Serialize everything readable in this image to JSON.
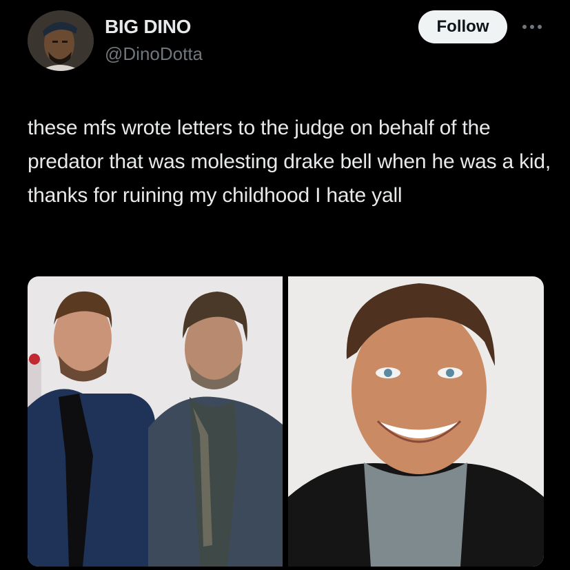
{
  "author": {
    "display_name": "BIG DINO",
    "handle": "@DinoDotta",
    "avatar_icon": "profile-avatar"
  },
  "header": {
    "follow_label": "Follow",
    "more_icon": "more-options-icon"
  },
  "tweet": {
    "text": "these mfs wrote letters to the judge on behalf of the predator that was molesting drake bell when he was a kid, thanks for ruining my childhood I hate yall"
  },
  "media": {
    "images": [
      {
        "description_icon": "photo-two-men"
      },
      {
        "description_icon": "photo-smiling-man"
      }
    ]
  },
  "colors": {
    "background": "#000000",
    "primary_text": "#e7e9ea",
    "secondary_text": "#71767b",
    "follow_bg": "#eff3f4"
  }
}
